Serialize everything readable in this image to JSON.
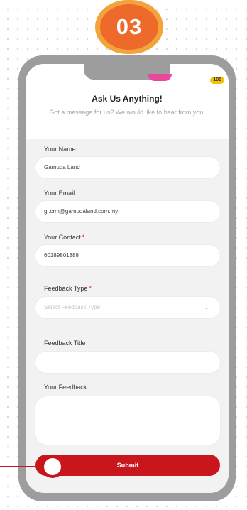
{
  "step_badge": "03",
  "corner_badge": "100",
  "form": {
    "title": "Ask Us Anything!",
    "subtitle": "Got a message for us? We would like to hear from you.",
    "name_label": "Your Name",
    "name_value": "Gamuda Land",
    "email_label": "Your Email",
    "email_value": "gl.crm@gamudaland.com.my",
    "contact_label": "Your Contact",
    "contact_value": "60189801888",
    "required_mark": "*",
    "feedback_type_label": "Feedback Type",
    "feedback_type_placeholder": "Select Feedback Type",
    "feedback_title_label": "Feedback Title",
    "feedback_title_value": "",
    "your_feedback_label": "Your Feedback",
    "your_feedback_value": "",
    "submit_label": "Submit"
  },
  "colors": {
    "accent_red": "#c8161c",
    "badge_orange": "#ee6a2a",
    "badge_ring": "#f2a33c"
  },
  "icons": {
    "dropdown": "chevron-down-icon",
    "pointer": "tap-indicator"
  }
}
